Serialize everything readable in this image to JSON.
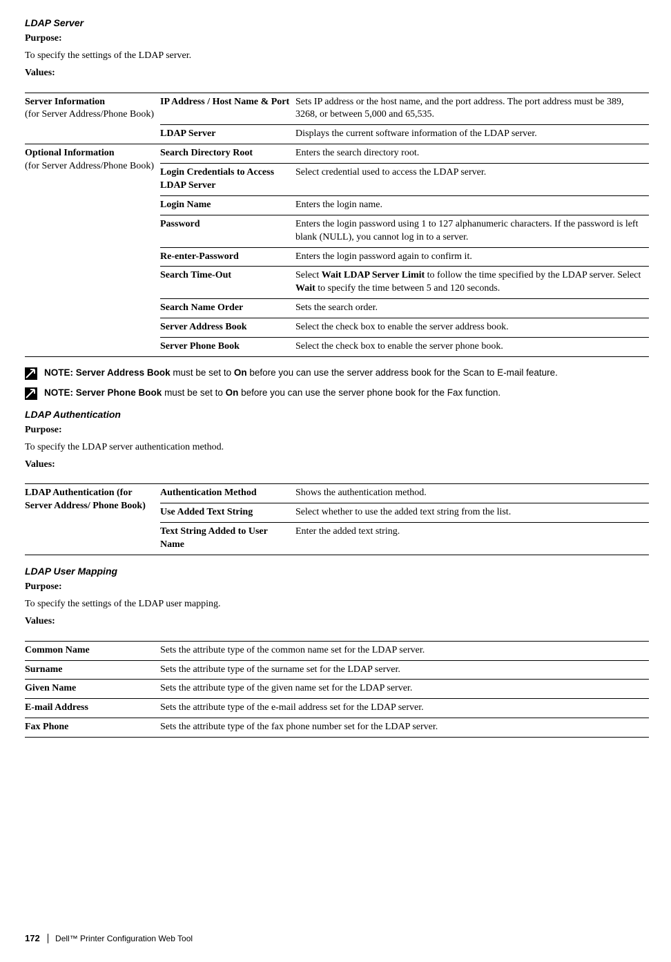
{
  "section1": {
    "title": "LDAP Server",
    "purpose_label": "Purpose:",
    "purpose_text": "To specify the settings of the LDAP server.",
    "values_label": "Values:",
    "group1": {
      "heading": "Server Information",
      "sub": "(for Server Address/Phone Book)",
      "rows": [
        {
          "name": "IP Address / Host Name & Port",
          "desc": "Sets IP address or the host name, and the port address. The port address must be 389, 3268, or between 5,000 and 65,535."
        },
        {
          "name": "LDAP Server",
          "desc": "Displays the current software information of the LDAP server."
        }
      ]
    },
    "group2": {
      "heading": "Optional Information",
      "sub": "(for Server Address/Phone Book)",
      "rows": [
        {
          "name": "Search Directory Root",
          "desc": "Enters the search directory root."
        },
        {
          "name": "Login Credentials to Access LDAP Server",
          "desc": "Select credential used to access the LDAP server."
        },
        {
          "name": "Login Name",
          "desc": "Enters the login name."
        },
        {
          "name": "Password",
          "desc": "Enters the login password using 1 to 127 alphanumeric characters. If the password is left blank (NULL), you cannot log in to a server."
        },
        {
          "name": "Re-enter-Password",
          "desc": "Enters the login password again to confirm it."
        },
        {
          "name": "Search Time-Out",
          "desc_pre": "Select ",
          "bold1": "Wait LDAP Server Limit",
          "desc_mid": " to follow the time specified by the LDAP server. Select ",
          "bold2": "Wait",
          "desc_post": " to specify the time between 5 and 120 seconds."
        },
        {
          "name": "Search Name Order",
          "desc": "Sets the search order."
        },
        {
          "name": "Server Address Book",
          "desc": "Select the check box to enable the server address book."
        },
        {
          "name": "Server Phone Book",
          "desc": "Select the check box to enable the server phone book."
        }
      ]
    }
  },
  "notes": {
    "label": "NOTE:",
    "n1_b1": "Server Address Book",
    "n1_mid": " must be set to ",
    "n1_b2": "On",
    "n1_post": " before you can use the server address book for the Scan to E-mail feature.",
    "n2_b1": "Server Phone Book",
    "n2_mid": " must be set to ",
    "n2_b2": "On",
    "n2_post": " before you can use the server phone book for the Fax function."
  },
  "section2": {
    "title": "LDAP Authentication",
    "purpose_label": "Purpose:",
    "purpose_text": "To specify the LDAP server authentication method.",
    "values_label": "Values:",
    "group": {
      "heading": "LDAP Authentication (for Server Address/ Phone Book)",
      "rows": [
        {
          "name": "Authentication Method",
          "desc": "Shows the authentication method."
        },
        {
          "name": "Use Added Text String",
          "desc": "Select whether to use the added text string from the list."
        },
        {
          "name": "Text String Added to User Name",
          "desc": "Enter the added text string."
        }
      ]
    }
  },
  "section3": {
    "title": "LDAP User Mapping",
    "purpose_label": "Purpose:",
    "purpose_text": "To specify the settings of the LDAP user mapping.",
    "values_label": "Values:",
    "rows": [
      {
        "name": "Common Name",
        "desc": "Sets the attribute type of the common name set for the LDAP server."
      },
      {
        "name": "Surname",
        "desc": "Sets the attribute type of the surname set for the LDAP server."
      },
      {
        "name": "Given Name",
        "desc": "Sets the attribute type of the given name set for the LDAP server."
      },
      {
        "name": "E-mail Address",
        "desc": "Sets the attribute type of the e-mail address set for the LDAP server."
      },
      {
        "name": "Fax Phone",
        "desc": "Sets the attribute type of the fax phone number set for the LDAP server."
      }
    ]
  },
  "footer": {
    "page": "172",
    "text": "Dell™ Printer Configuration Web Tool"
  }
}
